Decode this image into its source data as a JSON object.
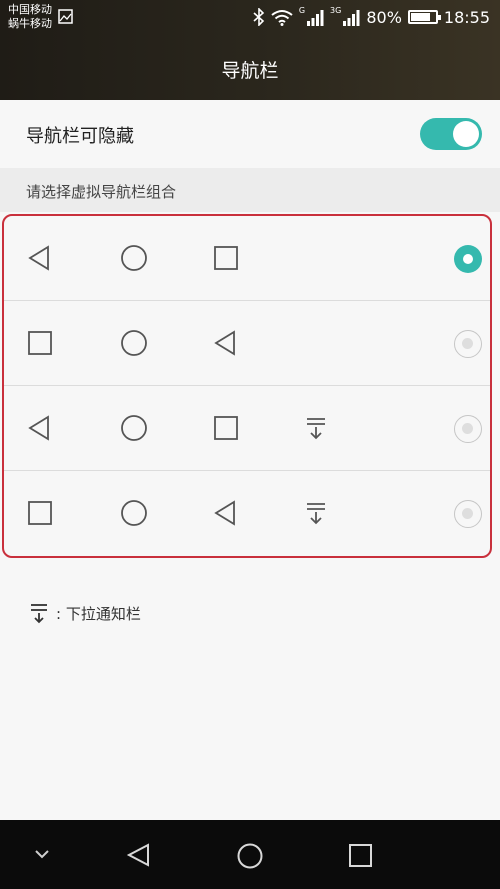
{
  "status_bar": {
    "carrier_1": "中国移动",
    "carrier_2": "蜗牛移动",
    "network_tag_1": "G",
    "network_tag_2": "3G",
    "battery": "80%",
    "battery_level": 0.8,
    "time": "18:55",
    "icons": [
      "picture-icon",
      "bluetooth-icon",
      "wifi-icon",
      "signal-icon",
      "signal-icon",
      "battery-icon"
    ]
  },
  "header": {
    "title": "导航栏"
  },
  "toggle": {
    "label": "导航栏可隐藏",
    "on": true
  },
  "section": {
    "title": "请选择虚拟导航栏组合"
  },
  "options": [
    {
      "icons": [
        "back",
        "home",
        "recents"
      ],
      "selected": true
    },
    {
      "icons": [
        "recents",
        "home",
        "back"
      ],
      "selected": false
    },
    {
      "icons": [
        "back",
        "home",
        "recents",
        "notification-pull"
      ],
      "selected": false
    },
    {
      "icons": [
        "recents",
        "home",
        "back",
        "notification-pull"
      ],
      "selected": false
    }
  ],
  "hint": {
    "text": ": 下拉通知栏"
  },
  "system_nav": {
    "icons": [
      "hide-chevron",
      "back",
      "home",
      "recents"
    ]
  },
  "colors": {
    "accent": "#35b9ae",
    "highlight_border": "#c9303c",
    "topbar": "#2b271d"
  }
}
